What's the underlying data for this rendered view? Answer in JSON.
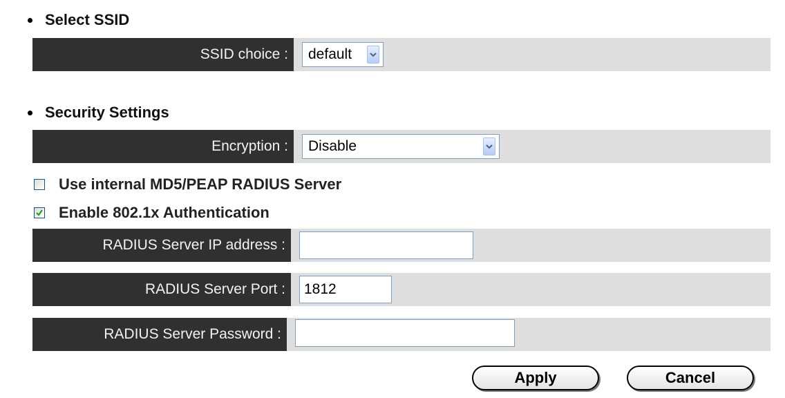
{
  "select_ssid_section": {
    "heading": "Select SSID",
    "ssid_choice": {
      "label": "SSID choice :",
      "selected": "default"
    }
  },
  "security_section": {
    "heading": "Security Settings",
    "encryption": {
      "label": "Encryption :",
      "selected": "Disable"
    },
    "radius_internal_checkbox": {
      "label": "Use internal MD5/PEAP RADIUS Server",
      "checked": false
    },
    "auth_8021x_checkbox": {
      "label": "Enable 802.1x Authentication",
      "checked": true
    },
    "radius_ip": {
      "label": "RADIUS Server IP address :",
      "value": ""
    },
    "radius_port": {
      "label": "RADIUS Server Port :",
      "value": "1812"
    },
    "radius_password": {
      "label": "RADIUS Server Password :",
      "value": ""
    }
  },
  "buttons": {
    "apply": "Apply",
    "cancel": "Cancel"
  },
  "colors": {
    "label_background": "#303030",
    "label_text": "#f2f2f2",
    "row_background": "#dedede",
    "input_border": "#7f9db9",
    "check_mark": "#21a121"
  },
  "icons": {
    "dropdown": "chevron-down-icon",
    "checkmark": "check-icon"
  }
}
